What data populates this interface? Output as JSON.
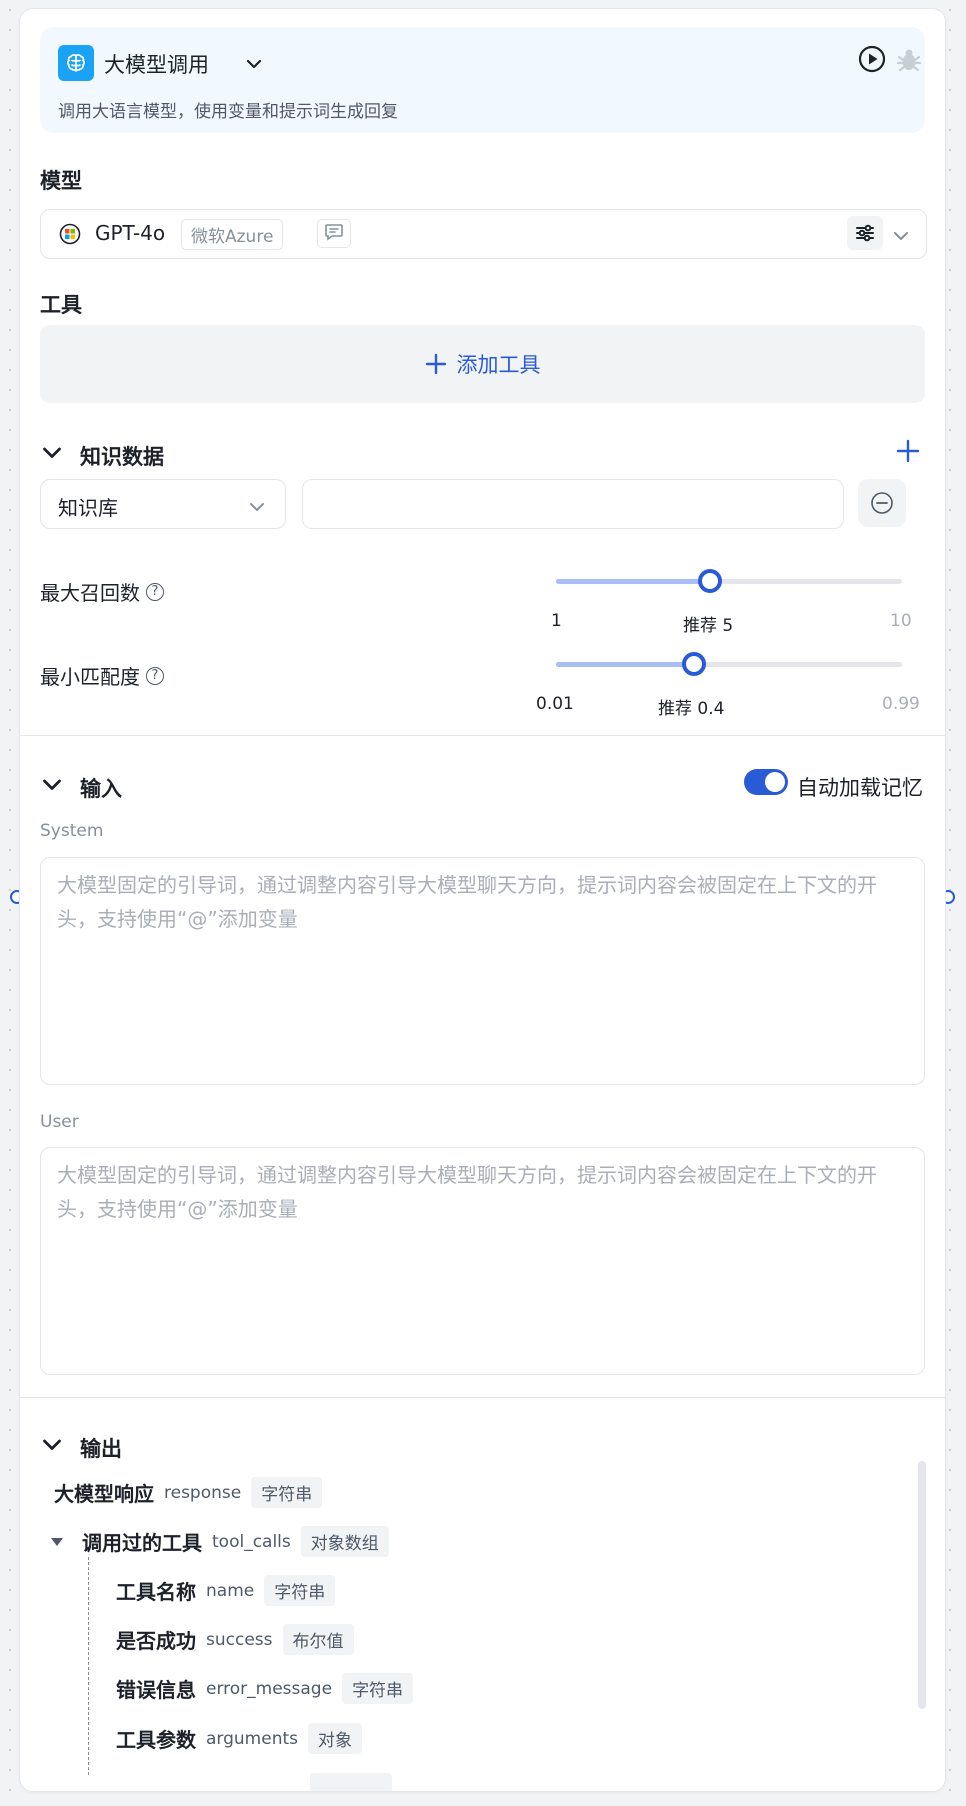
{
  "node": {
    "title": "大模型调用",
    "description": "调用大语言模型，使用变量和提示词生成回复",
    "node_icon": "brain-icon",
    "run_icon": "play-circle-icon",
    "debug_icon": "bug-icon"
  },
  "model_section": {
    "title": "模型",
    "model_name": "GPT-4o",
    "provider_tag": "微软Azure",
    "chat_icon": "chat-bubble-icon",
    "settings_icon": "sliders-icon"
  },
  "tools_section": {
    "title": "工具",
    "add_label": "添加工具"
  },
  "knowledge_section": {
    "title": "知识数据",
    "source_select": "知识库",
    "source_value": "",
    "max_recall": {
      "label": "最大召回数",
      "min": "1",
      "max": "10",
      "recommended": "推荐 5",
      "value": 5,
      "range": [
        1,
        10
      ]
    },
    "min_match": {
      "label": "最小匹配度",
      "min": "0.01",
      "max": "0.99",
      "recommended": "推荐 0.4",
      "value": 0.4,
      "range": [
        0.01,
        0.99
      ]
    }
  },
  "input_section": {
    "title": "输入",
    "memory_toggle_label": "自动加载记忆",
    "memory_toggle_on": true,
    "system_label": "System",
    "system_placeholder": "大模型固定的引导词，通过调整内容引导大模型聊天方向，提示词内容会被固定在上下文的开头，支持使用“@”添加变量",
    "user_label": "User",
    "user_placeholder": "大模型固定的引导词，通过调整内容引导大模型聊天方向，提示词内容会被固定在上下文的开头，支持使用“@”添加变量"
  },
  "output_section": {
    "title": "输出",
    "fields": [
      {
        "name": "大模型响应",
        "key": "response",
        "type": "字符串"
      },
      {
        "name": "调用过的工具",
        "key": "tool_calls",
        "type": "对象数组"
      }
    ],
    "children": [
      {
        "name": "工具名称",
        "key": "name",
        "type": "字符串"
      },
      {
        "name": "是否成功",
        "key": "success",
        "type": "布尔值"
      },
      {
        "name": "错误信息",
        "key": "error_message",
        "type": "字符串"
      },
      {
        "name": "工具参数",
        "key": "arguments",
        "type": "对象"
      }
    ]
  },
  "colors": {
    "accent": "#2a5bd7",
    "node_icon_bg": "#1aa3f5",
    "header_bg": "#f2f8ff"
  }
}
